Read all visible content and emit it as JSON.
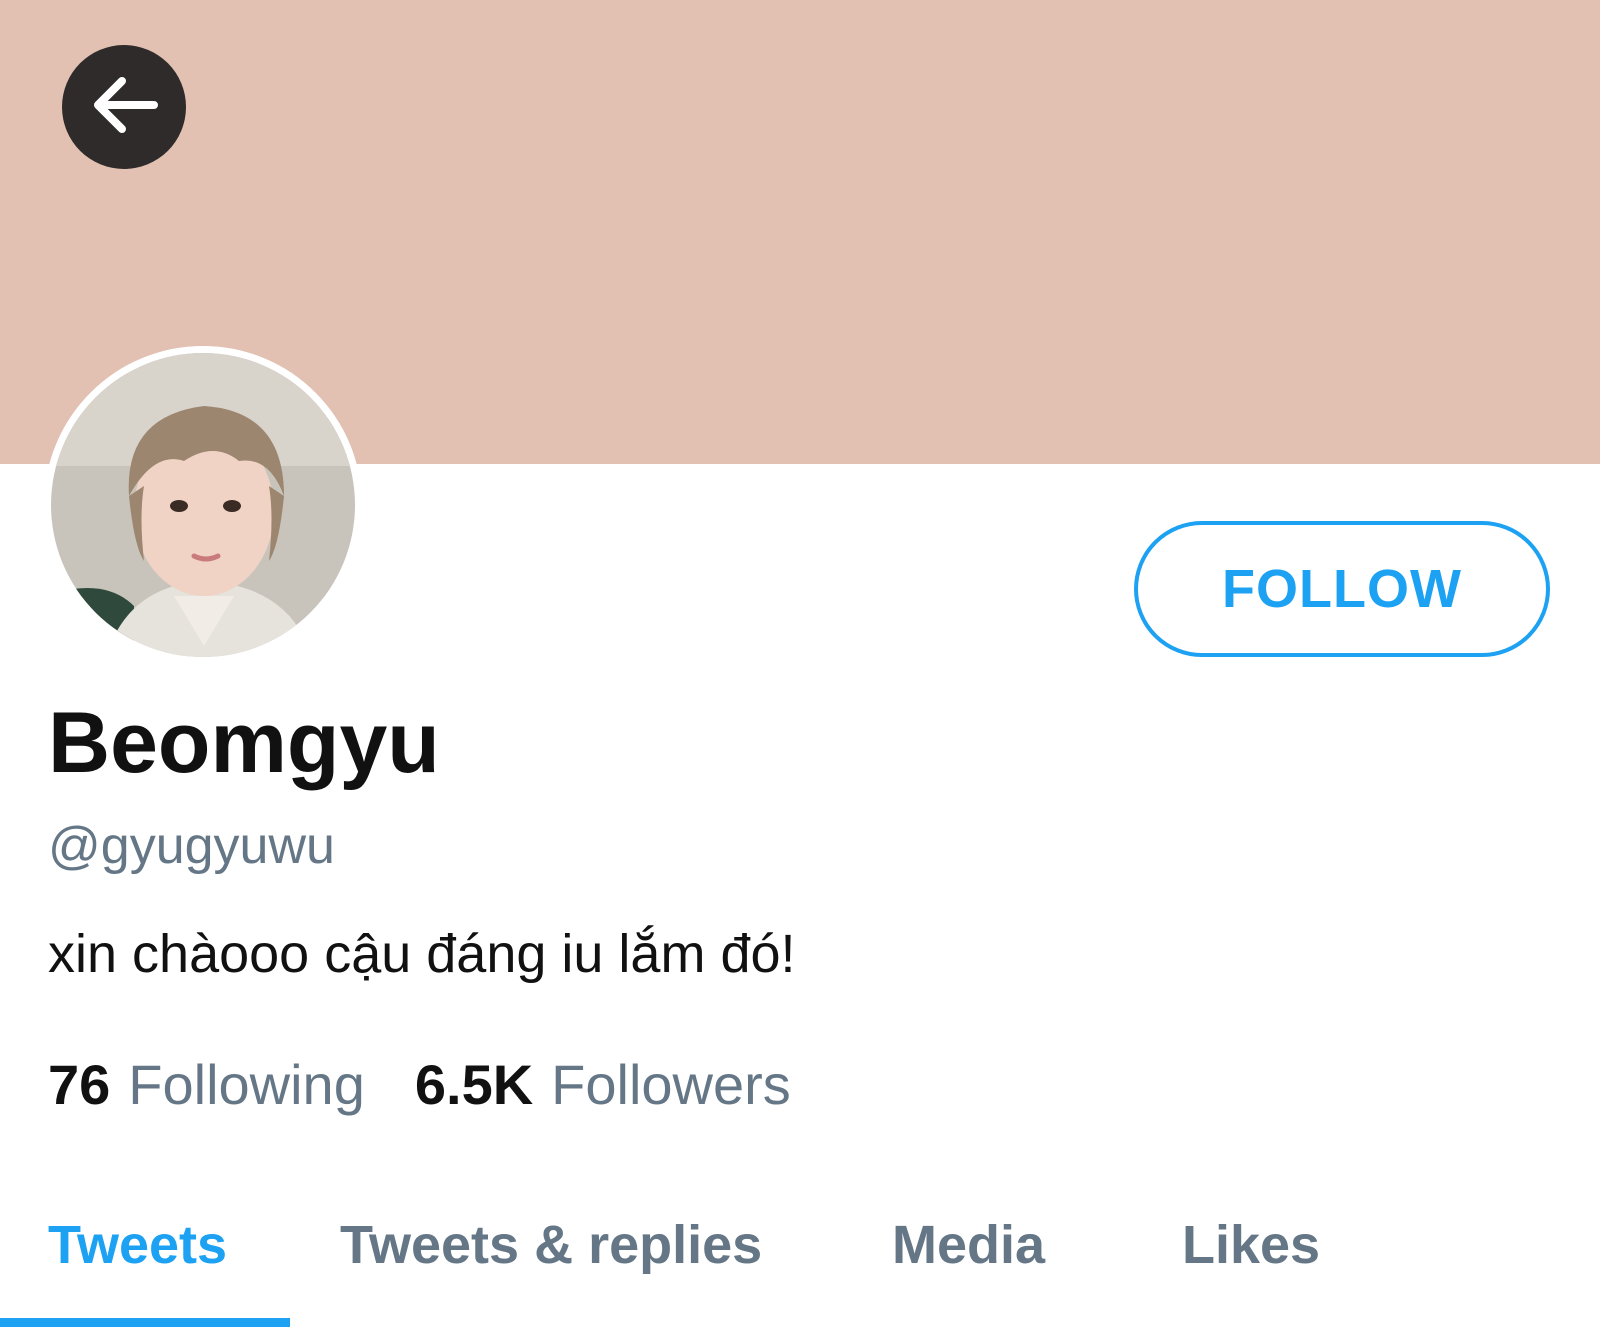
{
  "profile": {
    "display_name": "Beomgyu",
    "handle": "@gyugyuwu",
    "bio": "xin chàooo cậu đáng iu lắm đó!",
    "banner_color": "#e2c0b2"
  },
  "actions": {
    "follow_label": "FOLLOW",
    "back_icon": "arrow-left-icon"
  },
  "stats": {
    "following_count": "76",
    "following_label": "Following",
    "followers_count": "6.5K",
    "followers_label": "Followers"
  },
  "tabs": [
    {
      "label": "Tweets",
      "active": true
    },
    {
      "label": "Tweets & replies",
      "active": false
    },
    {
      "label": "Media",
      "active": false
    },
    {
      "label": "Likes",
      "active": false
    }
  ],
  "colors": {
    "accent": "#1da1f2",
    "muted": "#657786",
    "text": "#111111"
  }
}
